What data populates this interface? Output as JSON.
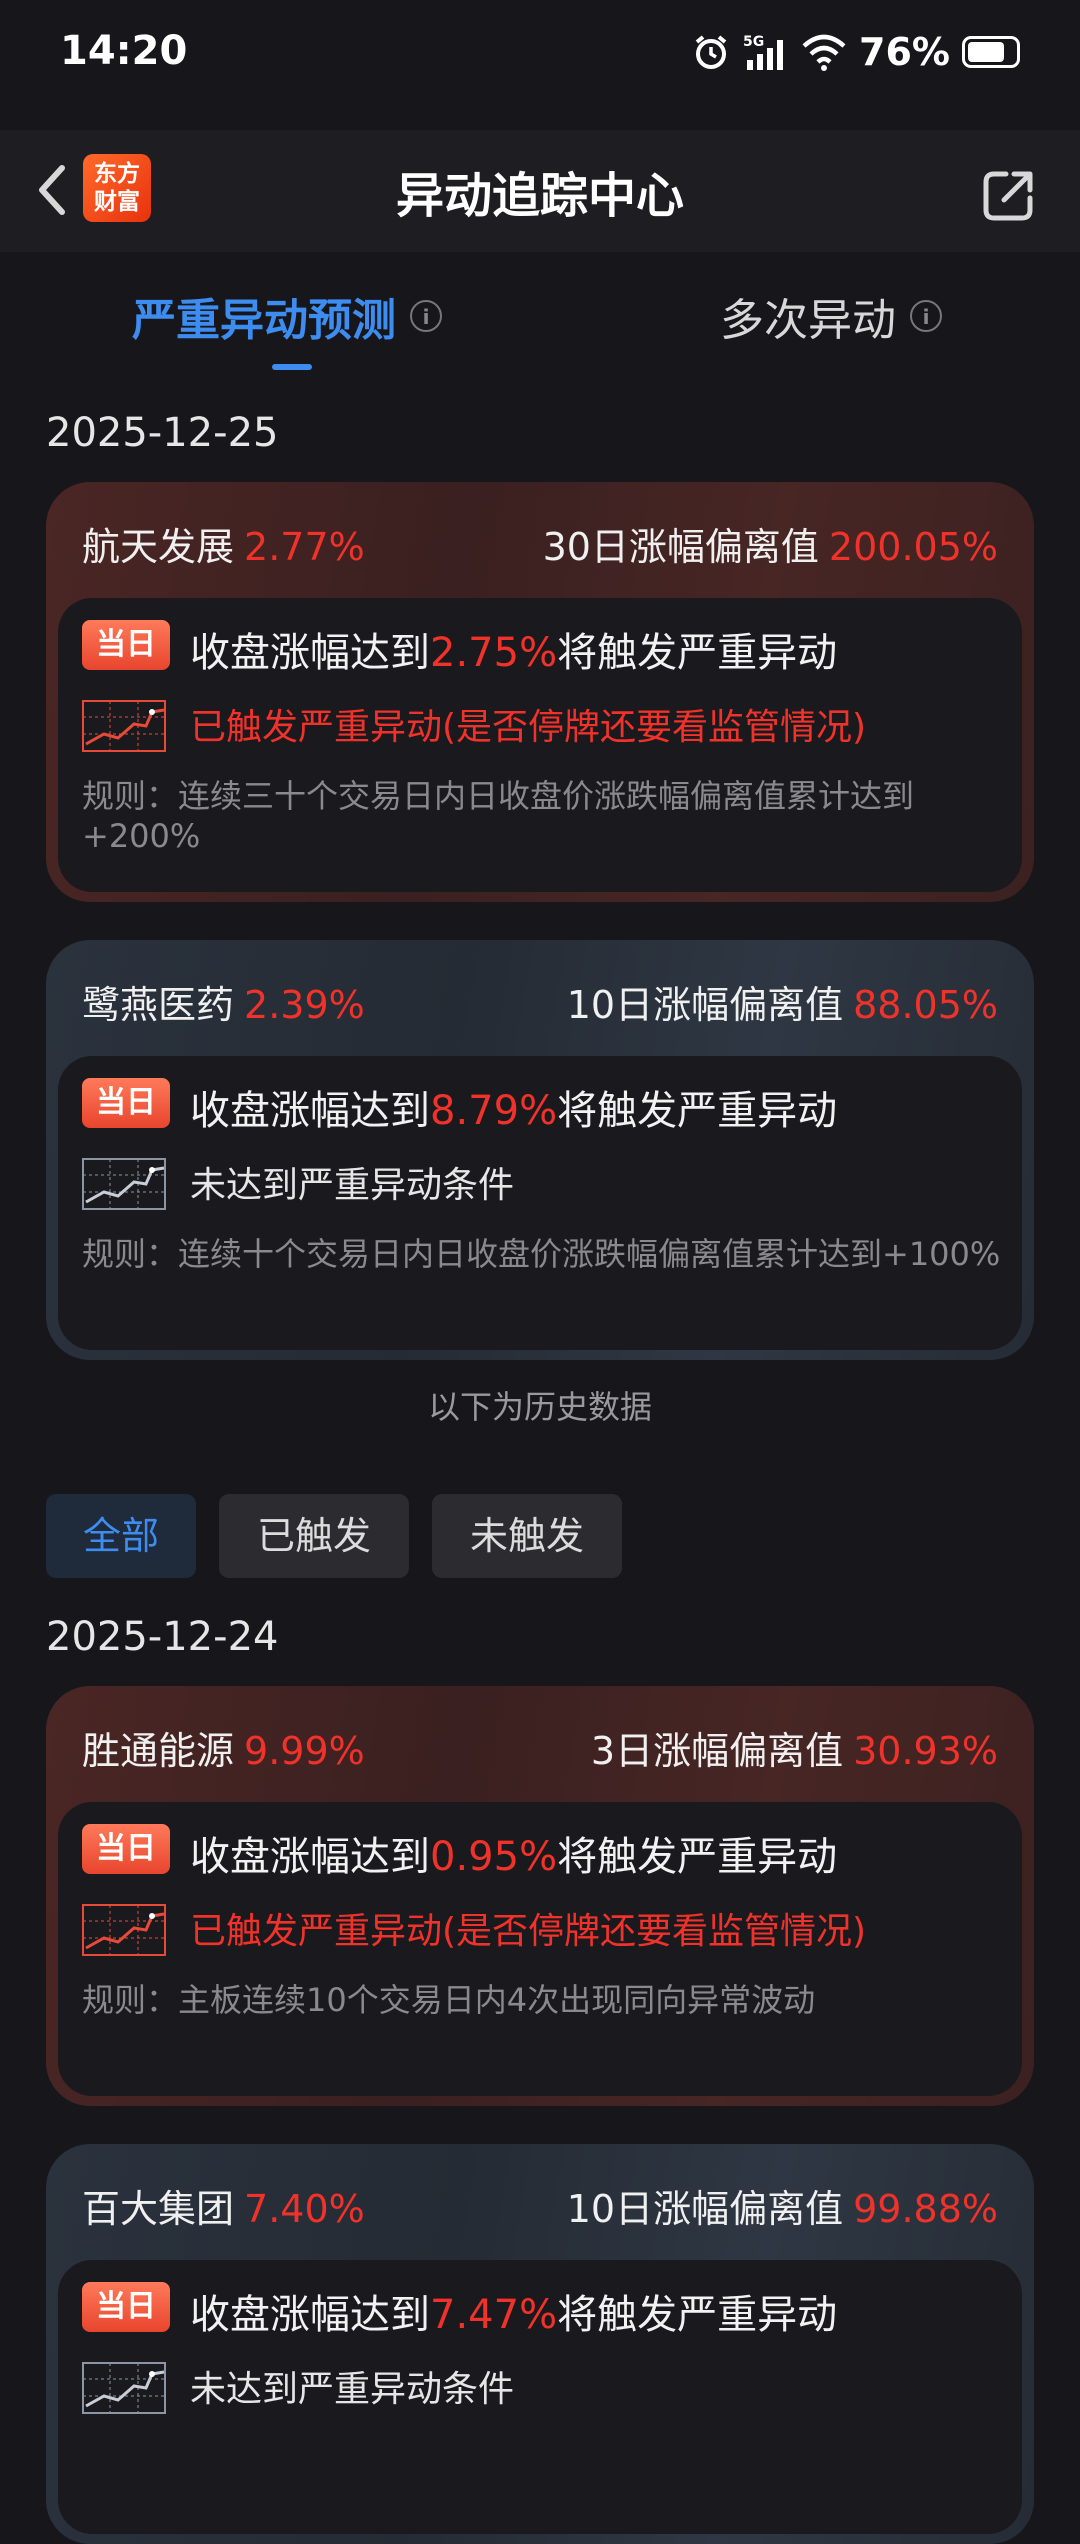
{
  "status": {
    "time": "14:20",
    "battery": "76%",
    "network": "5G"
  },
  "header": {
    "title": "异动追踪中心",
    "logo_line1": "东方",
    "logo_line2": "财富"
  },
  "tabs": [
    {
      "label": "严重异动预测"
    },
    {
      "label": "多次异动"
    }
  ],
  "today_date": "2025-12-25",
  "history_note": "以下为历史数据",
  "filters": [
    {
      "label": "全部"
    },
    {
      "label": "已触发"
    },
    {
      "label": "未触发"
    }
  ],
  "history_date": "2025-12-24",
  "cards": [
    {
      "name": "航天发展",
      "pct": "2.77%",
      "metric_label": "30日涨幅偏离值",
      "metric_value": "200.05%",
      "badge": "当日",
      "line_pre": "收盘涨幅达到",
      "line_val": "2.75%",
      "line_post": "将触发严重异动",
      "status": "已触发严重异动(是否停牌还要看监管情况)",
      "rule": "规则：连续三十个交易日内日收盘价涨跌幅偏离值累计达到+200%",
      "theme_color": "#4a2624"
    },
    {
      "name": "鹭燕医药",
      "pct": "2.39%",
      "metric_label": "10日涨幅偏离值",
      "metric_value": "88.05%",
      "badge": "当日",
      "line_pre": "收盘涨幅达到",
      "line_val": "8.79%",
      "line_post": "将触发严重异动",
      "status": "未达到严重异动条件",
      "rule": "规则：连续十个交易日内日收盘价涨跌幅偏离值累计达到+100%",
      "theme_color": "#2a323d"
    },
    {
      "name": "胜通能源",
      "pct": "9.99%",
      "metric_label": "3日涨幅偏离值",
      "metric_value": "30.93%",
      "badge": "当日",
      "line_pre": "收盘涨幅达到",
      "line_val": "0.95%",
      "line_post": "将触发严重异动",
      "status": "已触发严重异动(是否停牌还要看监管情况)",
      "rule": "规则：主板连续10个交易日内4次出现同向异常波动",
      "theme_color": "#4a2624"
    },
    {
      "name": "百大集团",
      "pct": "7.40%",
      "metric_label": "10日涨幅偏离值",
      "metric_value": "99.88%",
      "badge": "当日",
      "line_pre": "收盘涨幅达到",
      "line_val": "7.47%",
      "line_post": "将触发严重异动",
      "status": "未达到严重异动条件",
      "rule": "",
      "theme_color": "#2a323d"
    }
  ],
  "colors": {
    "accent_blue": "#3d8cf0",
    "alert_red": "#f0322a",
    "background": "#17171b"
  }
}
